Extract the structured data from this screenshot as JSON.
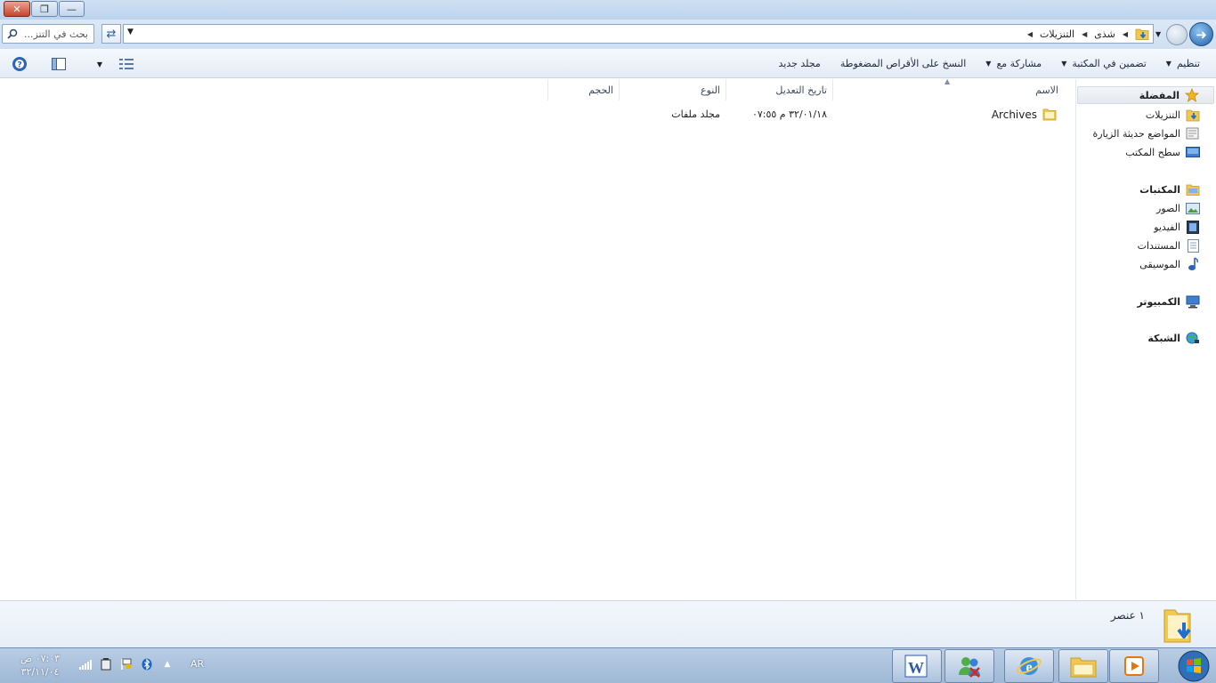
{
  "window": {
    "controls": {
      "close": "✕",
      "restore": "❐",
      "minimize": "—"
    }
  },
  "address": {
    "search_placeholder": "بحث في التنز...",
    "breadcrumb": [
      "شذى",
      "التنزيلات"
    ]
  },
  "toolbar": {
    "organize": "تنظيم",
    "include_in_library": "تضمين في المكتبة",
    "share_with": "مشاركة مع",
    "burn": "النسخ على الأقراص المضغوطة",
    "new_folder": "مجلد جديد"
  },
  "nav": {
    "favorites": "المفضلة",
    "downloads": "التنزيلات",
    "recent_places": "المواضع حديثة الزيارة",
    "desktop": "سطح المكتب",
    "libraries": "المكتبات",
    "pictures": "الصور",
    "videos": "الفيديو",
    "documents": "المستندات",
    "music": "الموسيقى",
    "computer": "الكمبيوتر",
    "network": "الشبكة"
  },
  "columns": {
    "name": "الاسم",
    "date_modified": "تاريخ التعديل",
    "type": "النوع",
    "size": "الحجم"
  },
  "files": [
    {
      "name": "Archives",
      "date_modified": "٣٢/٠١/١٨ م ٠٧:٥٥",
      "type": "مجلد ملفات",
      "size": ""
    }
  ],
  "details": {
    "item_count": "١ عنصر"
  },
  "taskbar": {
    "time": "٠٧:٠٣ ص",
    "date": "٣٢/١١/٠٤",
    "language": "AR",
    "tray_expand": "▲"
  },
  "colors": {
    "accent": "#1f5fa8",
    "folder": "#f2c94c",
    "taskbar": "#a9c1dd"
  }
}
